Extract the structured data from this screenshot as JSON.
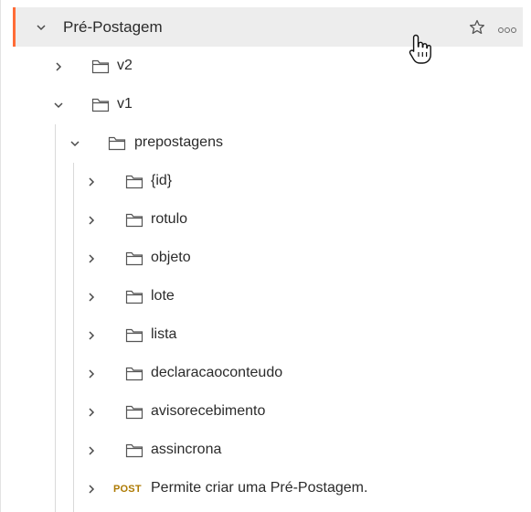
{
  "collection": {
    "name": "Pré-Postagem",
    "star_icon": "star-icon",
    "more_icon": "more-horizontal-icon"
  },
  "tree": {
    "v2": "v2",
    "v1": "v1",
    "prepostagens": "prepostagens",
    "children": [
      "{id}",
      "rotulo",
      "objeto",
      "lote",
      "lista",
      "declaracaoconteudo",
      "avisorecebimento",
      "assincrona"
    ],
    "request": {
      "method": "POST",
      "name": "Permite criar uma Pré-Postagem."
    }
  },
  "colors": {
    "accent": "#ff6c37",
    "post_method": "#ad7a03",
    "header_bg": "#ededed"
  }
}
